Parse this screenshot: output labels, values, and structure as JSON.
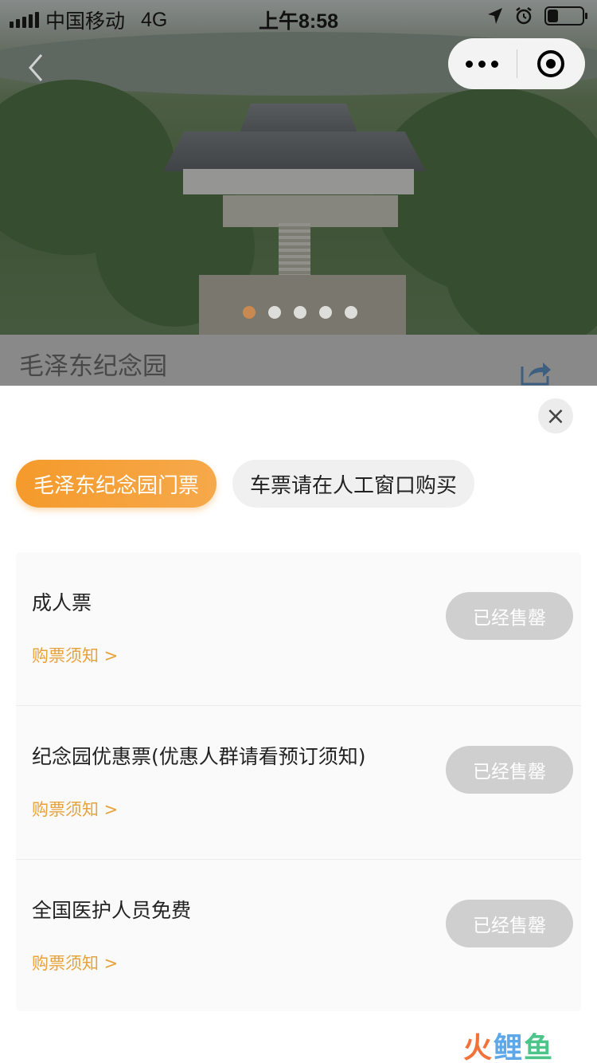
{
  "status_bar": {
    "carrier": "中国移动",
    "network": "4G",
    "time": "上午8:58",
    "battery_level": 0.3,
    "icons": [
      "signal-icon",
      "location-arrow-icon",
      "alarm-icon",
      "battery-icon"
    ]
  },
  "capsule": {
    "icons": [
      "more-icon",
      "close-miniprogram-icon"
    ]
  },
  "carousel": {
    "count": 5,
    "active_index": 0
  },
  "attraction": {
    "title": "毛泽东纪念园"
  },
  "tabs": [
    {
      "label": "毛泽东纪念园门票",
      "active": true
    },
    {
      "label": "车票请在人工窗口购买",
      "active": false
    }
  ],
  "tickets": [
    {
      "name": "成人票",
      "notice": "购票须知 >",
      "button": "已经售罄"
    },
    {
      "name": "纪念园优惠票(优惠人群请看预订须知)",
      "notice": "购票须知 >",
      "button": "已经售罄"
    },
    {
      "name": "全国医护人员免费",
      "notice": "购票须知 >",
      "button": "已经售罄"
    }
  ],
  "watermark": {
    "part1": "火",
    "part2": "鲤",
    "part3": "鱼"
  },
  "colors": {
    "accent": "#f59a2b",
    "notice": "#e8a23a",
    "soldout": "#cfcfcf"
  }
}
